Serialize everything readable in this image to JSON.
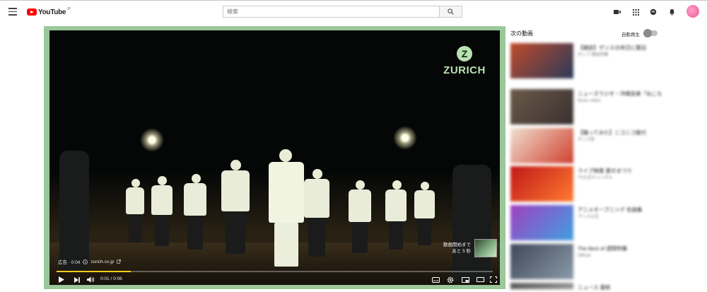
{
  "header": {
    "logo_text": "YouTube",
    "logo_region": "JP",
    "search_placeholder": "検索",
    "icons": [
      "menu-icon",
      "search-icon",
      "create-video-icon",
      "apps-grid-icon",
      "messages-icon",
      "notifications-bell-icon",
      "avatar"
    ]
  },
  "player": {
    "advertiser_logo_text": "ZURICH",
    "advertiser_emblem": "Z",
    "ad_label": "広告 · 0:04",
    "ad_link": "zurich.co.jp",
    "skip_line1": "動画開始まで",
    "skip_line2": "あと 5 秒",
    "time_display": "0:01 / 0:06",
    "progress_fraction": 0.17,
    "progress_color": "#f3cc1a",
    "controls": [
      "play-icon",
      "next-icon",
      "volume-icon",
      "subtitles-icon",
      "settings-icon",
      "miniplayer-icon",
      "theater-mode-icon",
      "fullscreen-icon"
    ]
  },
  "sidebar": {
    "up_next_label": "次の動画",
    "autoplay_label": "自動再生",
    "autoplay_on": false,
    "recommendations": [
      {
        "title": "【雑誌】ザンスの休日に繁店",
        "channel": "ポップ 雑誌特集",
        "stats": "",
        "colors": [
          "#c04a2a",
          "#2a3a5a"
        ]
      },
      {
        "title": "ニューズラジオ・沖縄音楽「ねこな",
        "channel": "Music Video",
        "stats": "",
        "colors": [
          "#6b5a4a",
          "#3a3030"
        ]
      },
      {
        "title": "【踊ってみた】ニコニコ振付",
        "channel": "ダンス部",
        "stats": "",
        "colors": [
          "#f0e0d0",
          "#d04030"
        ]
      },
      {
        "title": "ライブ映像 夏のまつり",
        "channel": "TV公式チャンネル",
        "stats": "",
        "colors": [
          "#c01818",
          "#ff7a30"
        ]
      },
      {
        "title": "アニメオープニング 名曲集",
        "channel": "アニメ公式",
        "stats": "",
        "colors": [
          "#a040c0",
          "#40a0e0"
        ]
      },
      {
        "title": "The Best of 週間特集",
        "channel": "Official",
        "stats": "",
        "colors": [
          "#404858",
          "#8a9aa8"
        ]
      },
      {
        "title": "ニュース 最新",
        "channel": "",
        "stats": "",
        "colors": [
          "#5a5a5a",
          "#9a9a9a"
        ]
      }
    ]
  }
}
